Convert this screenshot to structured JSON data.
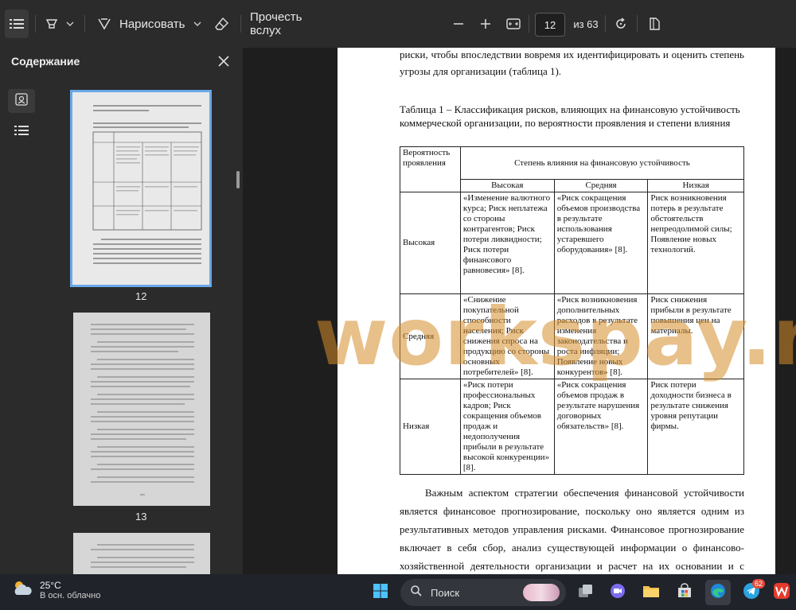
{
  "toolbar": {
    "draw_label": "Нарисовать",
    "read_aloud_label": "Прочесть вслух",
    "page_current": "12",
    "page_total_label": "из 63",
    "icons": [
      "contents-icon",
      "highlight-icon",
      "chevron-down-icon",
      "draw-icon",
      "chevron-down-icon",
      "eraser-icon",
      "minus-icon",
      "plus-icon",
      "fit-page-icon",
      "rotate-icon",
      "page-view-icon"
    ]
  },
  "sidebar": {
    "title": "Содержание",
    "tabs": [
      "thumbnails-icon",
      "outline-icon"
    ],
    "thumbnails": [
      {
        "label": "12",
        "selected": true
      },
      {
        "label": "13",
        "selected": false
      },
      {
        "label": "",
        "selected": false
      }
    ]
  },
  "document": {
    "intro_line1": "риски, чтобы впоследствии вовремя их идентифицировать и оценить степень",
    "intro_line2": "угрозы для организации (таблица 1).",
    "caption_line1": "Таблица 1 – Классификация рисков, влияющих на финансовую устойчивость",
    "caption_line2": "коммерческой организации, по вероятности проявления и степени влияния",
    "table": {
      "corner_header": "Вероятность проявления",
      "group_header": "Степень влияния на финансовую устойчивость",
      "col_headers": [
        "Высокая",
        "Средняя",
        "Низкая"
      ],
      "rows": [
        {
          "label": "Высокая",
          "cells": [
            "«Изменение валютного курса; Риск неплатежа со стороны контрагентов; Риск потери ликвидности; Риск потери финансового равновесия» [8].",
            "«Риск сокращения объемов производства в результате использования устаревшего оборудования» [8].",
            "Риск возникновения потерь в результате обстоятельств непреодолимой силы; Появление новых технологий."
          ]
        },
        {
          "label": "Средняя",
          "cells": [
            "«Снижение покупательной способности населения; Риск снижения спроса на продукцию со стороны основных потребителей» [8].",
            "«Риск возникновения дополнительных расходов в результате изменения законодательства и роста инфляции; Появление новых конкурентов» [8].",
            "Риск снижения прибыли в результате повышения цен на материалы."
          ]
        },
        {
          "label": "Низкая",
          "cells": [
            "«Риск потери профессиональных кадров; Риск сокращения объемов продаж и недополучения прибыли в результате высокой конкуренции» [8].",
            "«Риск сокращения объемов продаж в результате нарушения договорных обязательств» [8].",
            "Риск потери доходности бизнеса в результате снижения уровня репутации фирмы."
          ]
        }
      ]
    },
    "para_lines": [
      "Важным аспектом стратегии обеспечения финансовой устойчивости",
      "является финансовое прогнозирование, поскольку оно является одним из",
      "результативных методов управления рисками. Финансовое прогнозирование",
      "включает в себя сбор, анализ существующей информации о финансово-",
      "хозяйственной деятельности организации и расчет на их основании и с учетом"
    ],
    "watermark": "workspay.ru"
  },
  "taskbar": {
    "weather_temp": "25°C",
    "weather_desc": "В осн. облачно",
    "search_label": "Поиск",
    "telegram_badge": "62",
    "icons": [
      "weather-cloud-icon",
      "start-windows-icon",
      "search-icon",
      "task-view-icon",
      "chat-icon",
      "file-explorer-icon",
      "store-icon",
      "edge-icon",
      "telegram-icon",
      "wps-office-icon"
    ]
  },
  "colors": {
    "toolbar_bg": "#2b2b2b",
    "viewer_bg": "#1e1e1e",
    "watermark": "#d68c28",
    "selected_thumb_border": "#6aa9e9"
  }
}
